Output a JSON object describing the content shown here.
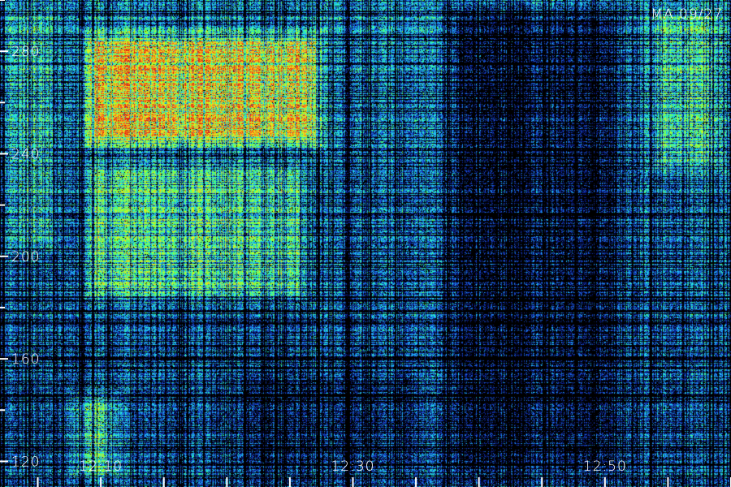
{
  "station_label": "MA 09/27",
  "chart_data": {
    "type": "heatmap",
    "title": "",
    "xlabel": "",
    "ylabel": "",
    "x_axis": {
      "unit": "time (HH:MM)",
      "range": [
        "12:02",
        "13:00"
      ],
      "labeled_ticks": [
        "12:10",
        "12:30",
        "12:50"
      ],
      "minor_tick_interval_minutes": 5
    },
    "y_axis": {
      "range": [
        110,
        300
      ],
      "labeled_ticks": [
        120,
        160,
        200,
        240,
        280
      ],
      "minor_tick_interval": 20
    },
    "colormap": [
      "#000000",
      "#0a1a8c",
      "#1e5adc",
      "#1ec8ff",
      "#28ffb4",
      "#78ff3c",
      "#d2ff1e",
      "#ffd21e",
      "#ff6e14",
      "#dc1e14"
    ],
    "regions": [
      {
        "time_range": [
          "12:02",
          "12:07"
        ],
        "value_range": [
          200,
          300
        ],
        "level": 0.45
      },
      {
        "time_range": [
          "12:08",
          "12:28"
        ],
        "value_range": [
          240,
          290
        ],
        "level": 0.85
      },
      {
        "time_range": [
          "12:08",
          "12:27"
        ],
        "value_range": [
          180,
          240
        ],
        "level": 0.55
      },
      {
        "time_range": [
          "12:07",
          "12:12"
        ],
        "value_range": [
          110,
          150
        ],
        "level": 0.5
      },
      {
        "time_range": [
          "12:20",
          "12:36"
        ],
        "value_range": [
          110,
          160
        ],
        "level": 0.15
      },
      {
        "time_range": [
          "12:37",
          "12:52"
        ],
        "value_range": [
          110,
          300
        ],
        "level": 0.1
      },
      {
        "time_range": [
          "12:53",
          "13:00"
        ],
        "value_range": [
          230,
          300
        ],
        "level": 0.5
      }
    ]
  },
  "colors": {
    "background": "#000000",
    "axis_text": "#ffffff",
    "tick_marks": "#ffffff"
  }
}
